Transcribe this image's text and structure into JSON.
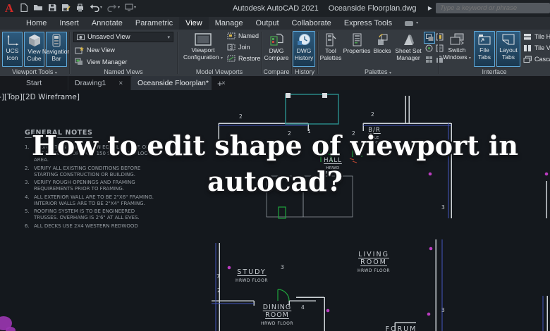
{
  "titlebar": {
    "app_title": "Autodesk AutoCAD 2021",
    "doc_title": "Oceanside Floorplan.dwg",
    "search_placeholder": "Type a keyword or phrase"
  },
  "ribbon": {
    "tabs": [
      {
        "label": "Home"
      },
      {
        "label": "Insert"
      },
      {
        "label": "Annotate"
      },
      {
        "label": "Parametric"
      },
      {
        "label": "View"
      },
      {
        "label": "Manage"
      },
      {
        "label": "Output"
      },
      {
        "label": "Collaborate"
      },
      {
        "label": "Express Tools"
      }
    ],
    "viewport_tools": {
      "label": "Viewport Tools",
      "ucs": "UCS Icon",
      "viewcube": "View Cube",
      "navbar": "Navigation Bar"
    },
    "named_views": {
      "label": "Named Views",
      "dropdown": "Unsaved View",
      "new_view": "New View",
      "view_manager": "View Manager"
    },
    "model_viewports": {
      "label": "Model Viewports",
      "config": "Viewport Configuration",
      "named": "Named",
      "join": "Join",
      "restore": "Restore"
    },
    "compare": {
      "label": "Compare",
      "dwg_compare": "DWG Compare"
    },
    "history": {
      "label": "History",
      "dwg_history": "DWG History"
    },
    "palettes": {
      "label": "Palettes",
      "tool_palettes": "Tool Palettes",
      "properties": "Properties",
      "blocks": "Blocks",
      "sheet_set": "Sheet Set Manager"
    },
    "interface": {
      "label": "Interface",
      "switch_windows": "Switch Windows",
      "file_tabs": "File Tabs",
      "layout_tabs": "Layout Tabs",
      "tile_h": "Tile Horizontally",
      "tile_v": "Tile Vertically",
      "cascade": "Cascade"
    }
  },
  "file_tabs": {
    "start": "Start",
    "drawing1": "Drawing1",
    "active": "Oceanside Floorplan*",
    "close": "×",
    "new_tab": "+"
  },
  "canvas": {
    "viewport_controls": "[-][Top][2D Wireframe]",
    "overlay_title": "How to edit shape of viewport in autocad?",
    "notes": {
      "title": "GENERAL NOTES",
      "items": [
        "FOUNDATION VENTILATION EQUAL TO 1 SF. OF NET OPENING FOR EACH 150 SF. UNDER FLOOR AREA.",
        "VERIFY ALL EXISTING CONDITIONS BEFORE STARTING CONSTRUCTION OR BUILDING.",
        "VERIFY ROUGH OPENINGS AND FRAMING REQUIREMENTS PRIOR TO FRAMING.",
        "ALL EXTERIOR WALL ARE TO BE 2\"X6\" FRAMING. INTERIOR WALLS ARE TO BE 2\"X4\" FRAMING.",
        "ROOFING SYSTEM IS TO BE ENGINEERED TRUSSES. OVERHANG IS 2'6\" AT ALL EVES.",
        "ALL DECKS USE 2X4 WESTERN REDWOOD"
      ]
    },
    "rooms": [
      {
        "name": "B/R",
        "floor": "TILE FLOOR"
      },
      {
        "name": "HALL",
        "floor": "HRWD FLOOR"
      },
      {
        "name": "LIVING ROOM",
        "floor": "HRWD FLOOR"
      },
      {
        "name": "STUDY",
        "floor": "HRWD FLOOR"
      },
      {
        "name": "DINING ROOM",
        "floor": "HRWD FLOOR"
      },
      {
        "name": "FORUM",
        "floor": ""
      }
    ],
    "plan_numbers": [
      "2",
      "2",
      "1",
      "2",
      "2",
      "3",
      "7",
      "2",
      "3",
      "4",
      "3"
    ]
  },
  "colors": {
    "accent_blue": "#5fa8d8",
    "wall_white": "#cdd2d6",
    "wall_blue": "#4456c0",
    "door_green": "#1fa43c",
    "marker_magenta": "#bb3cc0",
    "teal_wall": "#2a8f8d"
  }
}
